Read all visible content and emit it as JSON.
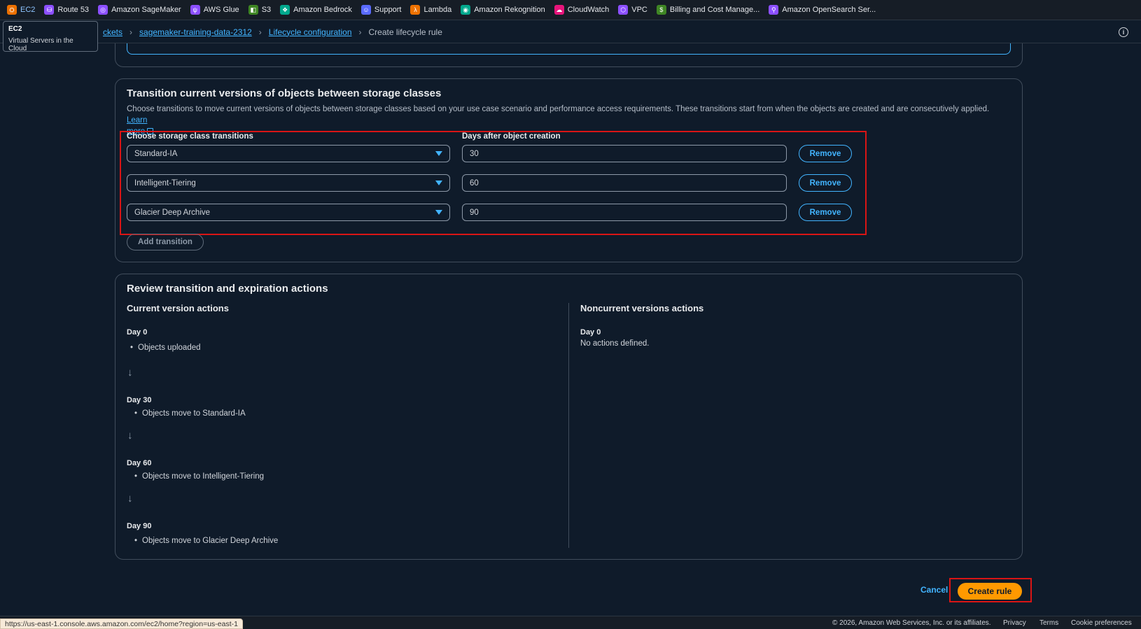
{
  "favorites": [
    {
      "label": "EC2",
      "color": "#ed7100",
      "glyph": "⛭",
      "active": true
    },
    {
      "label": "Route 53",
      "color": "#8c4fff",
      "glyph": "⛁"
    },
    {
      "label": "Amazon SageMaker",
      "color": "#8c4fff",
      "glyph": "◎"
    },
    {
      "label": "AWS Glue",
      "color": "#8c4fff",
      "glyph": "ψ"
    },
    {
      "label": "S3",
      "color": "#3f8624",
      "glyph": "◧"
    },
    {
      "label": "Amazon Bedrock",
      "color": "#01a88d",
      "glyph": "❖"
    },
    {
      "label": "Support",
      "color": "#5a6bff",
      "glyph": "☺"
    },
    {
      "label": "Lambda",
      "color": "#ed7100",
      "glyph": "λ"
    },
    {
      "label": "Amazon Rekognition",
      "color": "#01a88d",
      "glyph": "◉"
    },
    {
      "label": "CloudWatch",
      "color": "#e7157b",
      "glyph": "☁"
    },
    {
      "label": "VPC",
      "color": "#8c4fff",
      "glyph": "⬡"
    },
    {
      "label": "Billing and Cost Manage...",
      "color": "#3f8624",
      "glyph": "$"
    },
    {
      "label": "Amazon OpenSearch Ser...",
      "color": "#8c4fff",
      "glyph": "⚲"
    }
  ],
  "tooltip": {
    "title": "EC2",
    "subtitle": "Virtual Servers in the Cloud"
  },
  "breadcrumb": {
    "item1": "ckets",
    "item2": "sagemaker-training-data-2312",
    "item3": "Lifecycle configuration",
    "current": "Create lifecycle rule"
  },
  "transitions_section": {
    "title": "Transition current versions of objects between storage classes",
    "description": "Choose transitions to move current versions of objects between storage classes based on your use case scenario and performance access requirements. These transitions start from when the objects are created and are consecutively applied.",
    "learn_more_1": "Learn",
    "learn_more_2": "more",
    "col_storage": "Choose storage class transitions",
    "col_days": "Days after object creation",
    "rows": [
      {
        "storage_class": "Standard-IA",
        "days": "30"
      },
      {
        "storage_class": "Intelligent-Tiering",
        "days": "60"
      },
      {
        "storage_class": "Glacier Deep Archive",
        "days": "90"
      }
    ],
    "remove_label": "Remove",
    "add_label": "Add transition"
  },
  "review_section": {
    "title": "Review transition and expiration actions",
    "current_title": "Current version actions",
    "current": [
      {
        "day": "Day 0",
        "action": "Objects uploaded"
      },
      {
        "day": "Day 30",
        "action": "Objects move to Standard-IA"
      },
      {
        "day": "Day 60",
        "action": "Objects move to Intelligent-Tiering"
      },
      {
        "day": "Day 90",
        "action": "Objects move to Glacier Deep Archive"
      }
    ],
    "noncurrent_title": "Noncurrent versions actions",
    "noncurrent_day": "Day 0",
    "noncurrent_text": "No actions defined."
  },
  "actions": {
    "cancel": "Cancel",
    "create": "Create rule"
  },
  "footer": {
    "copyright": "© 2026, Amazon Web Services, Inc. or its affiliates.",
    "privacy": "Privacy",
    "terms": "Terms",
    "cookies": "Cookie preferences"
  },
  "status_url": "https://us-east-1.console.aws.amazon.com/ec2/home?region=us-east-1"
}
